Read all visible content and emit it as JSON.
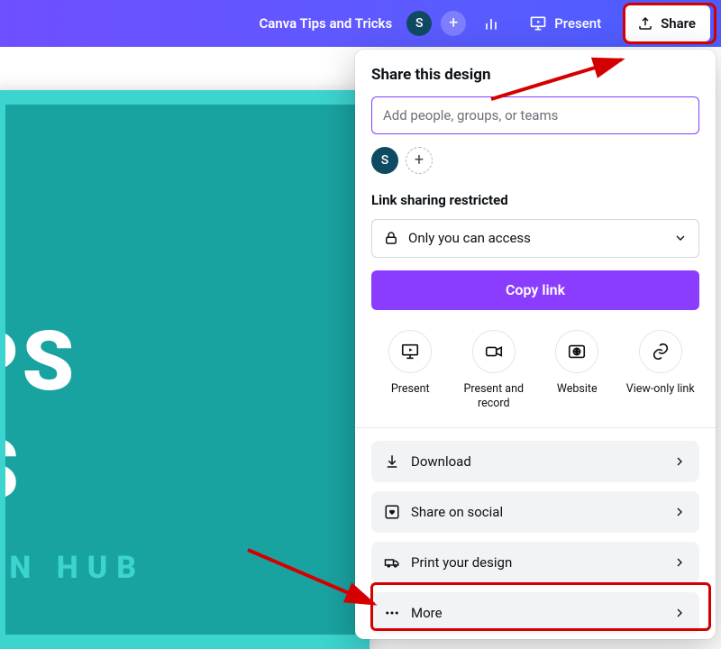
{
  "header": {
    "doc_title": "Canva Tips and Tricks",
    "avatar_initial": "S",
    "present_label": "Present",
    "share_label": "Share"
  },
  "canvas": {
    "title_line1": "A TIPS",
    "title_line2": "CKS",
    "subtitle": "SIGN HUB"
  },
  "share_panel": {
    "title": "Share this design",
    "people_placeholder": "Add people, groups, or teams",
    "avatar_initial": "S",
    "link_section_label": "Link sharing restricted",
    "access_label": "Only you can access",
    "copy_link_label": "Copy link",
    "tiles": [
      {
        "label": "Present"
      },
      {
        "label": "Present and record"
      },
      {
        "label": "Website"
      },
      {
        "label": "View-only link"
      }
    ],
    "actions": [
      {
        "label": "Download"
      },
      {
        "label": "Share on social"
      },
      {
        "label": "Print your design"
      },
      {
        "label": "More"
      }
    ]
  }
}
